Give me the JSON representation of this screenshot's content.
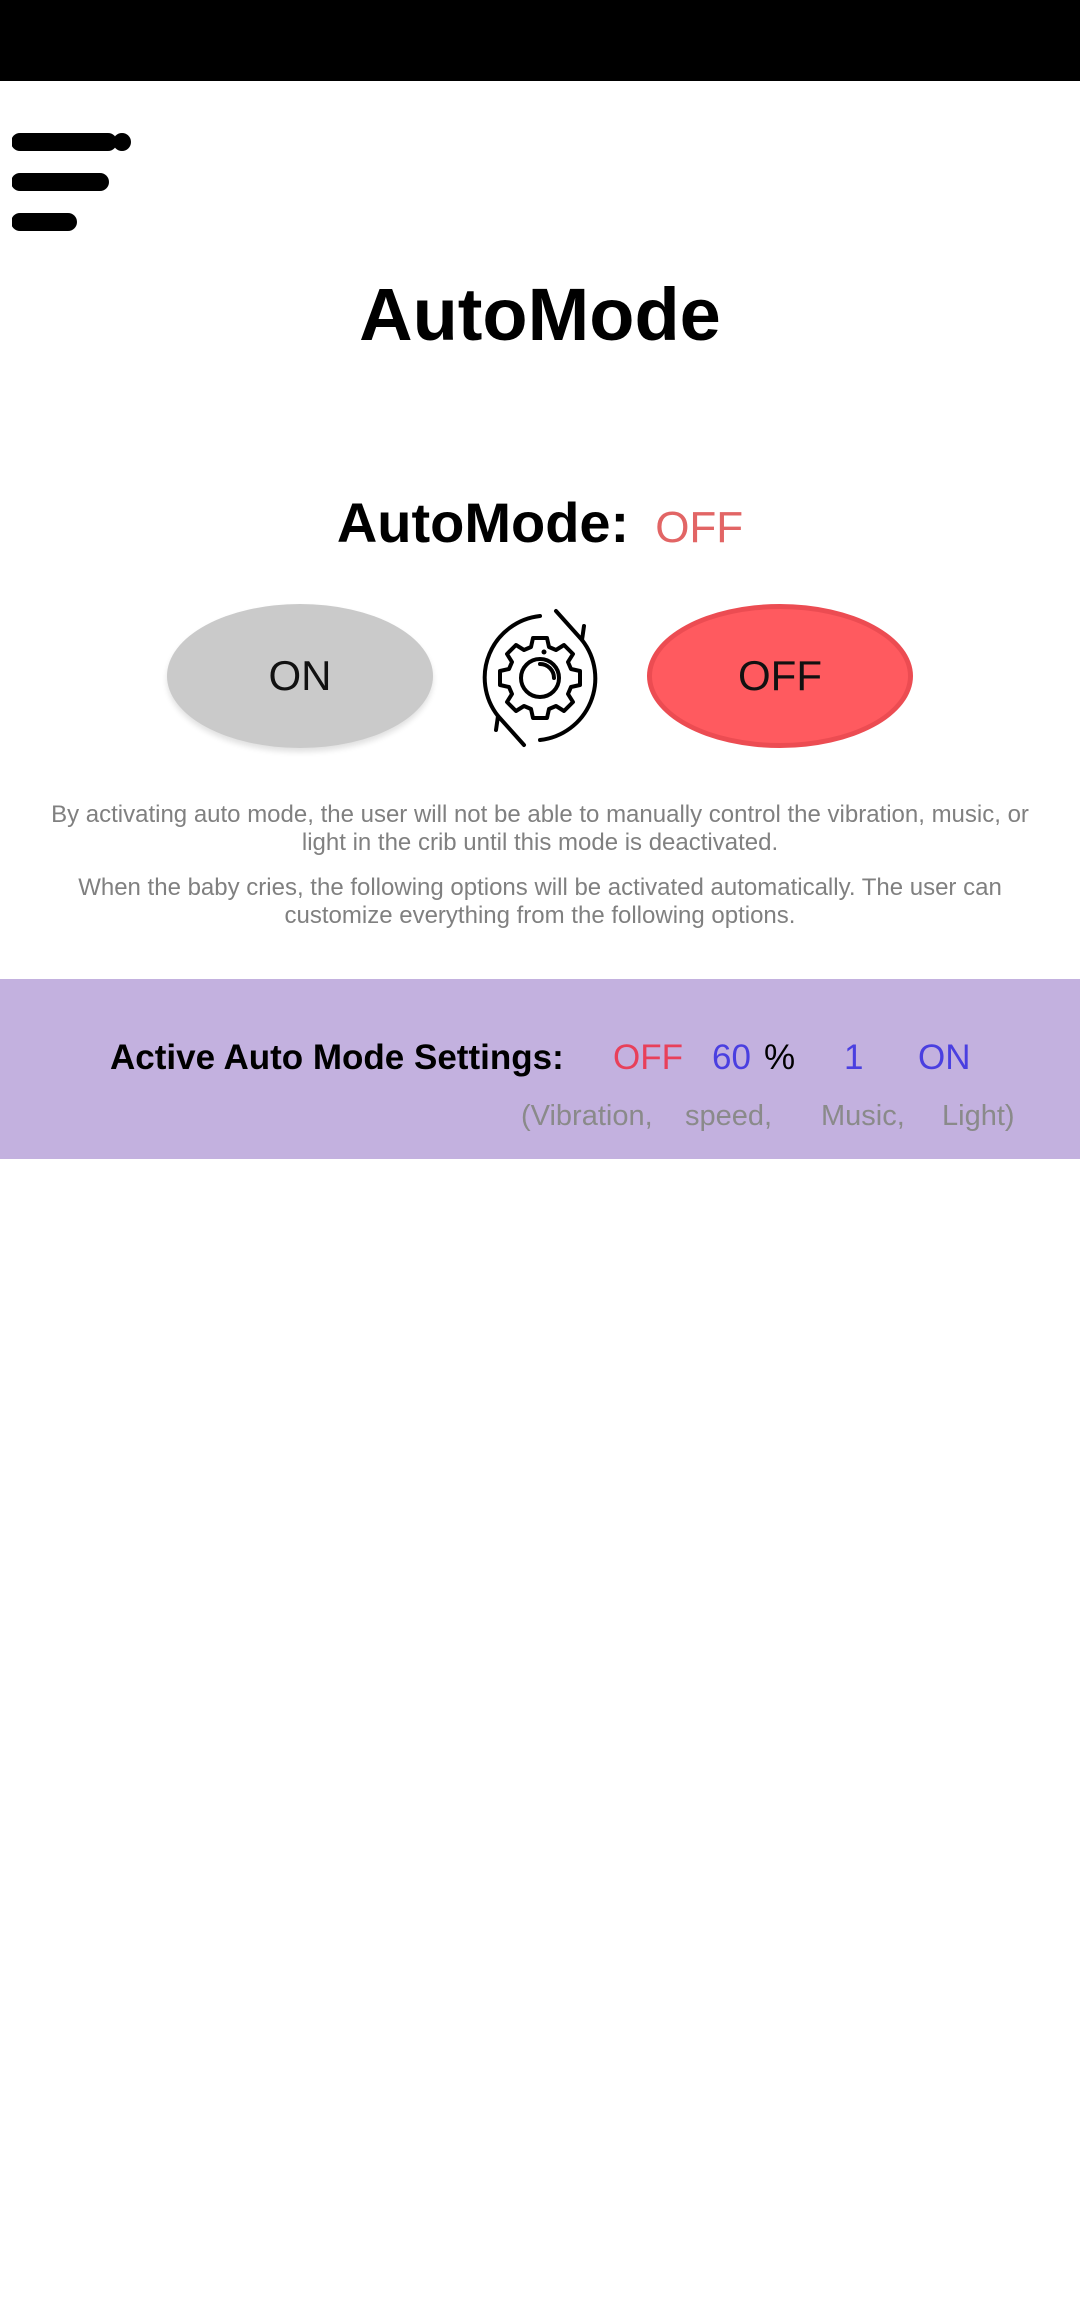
{
  "header": {
    "menu_icon": "menu-icon"
  },
  "page_title": "AutoMode",
  "mode_status": {
    "label": "AutoMode:",
    "value": "OFF",
    "value_color": "#e26565"
  },
  "buttons": {
    "on_label": "ON",
    "off_label": "OFF",
    "settings_icon": "gear-refresh-icon",
    "on_color": "#cacaca",
    "off_color": "#ff5a5f"
  },
  "description": {
    "paragraph_1": "By activating auto mode, the user will not be able to manually control the vibration, music, or light in the crib until this mode is deactivated.",
    "paragraph_2": "When the baby cries, the following options will be activated automatically. The user can customize everything from the following options."
  },
  "settings": {
    "label": "Active Auto Mode Settings:",
    "panel_color": "#c3b1df",
    "vibration": {
      "value": "OFF",
      "caption": "(Vibration,",
      "color": "#e8405a"
    },
    "speed": {
      "value": "60",
      "unit": "%",
      "caption": "speed,",
      "color": "#4a3fe0"
    },
    "music": {
      "value": "1",
      "caption": "Music,",
      "color": "#4a3fe0"
    },
    "light": {
      "value": "ON",
      "caption": "Light)",
      "color": "#4a3fe0"
    }
  }
}
